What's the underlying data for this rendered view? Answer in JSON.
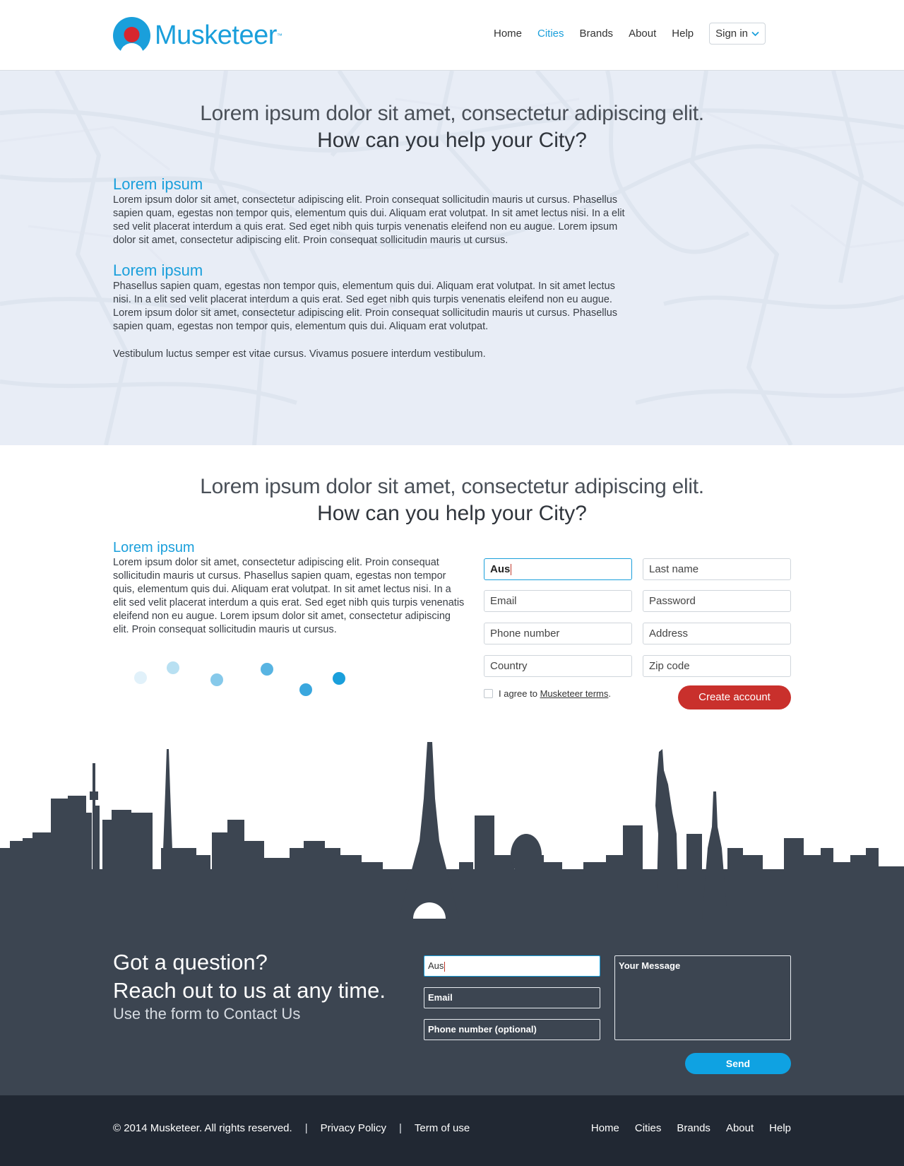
{
  "brand": {
    "name": "Musketeer",
    "tm": "™",
    "primary_color": "#1a9fdb",
    "accent_color": "#d7262e"
  },
  "nav": {
    "items": [
      {
        "label": "Home",
        "active": false
      },
      {
        "label": "Cities",
        "active": true
      },
      {
        "label": "Brands",
        "active": false
      },
      {
        "label": "About",
        "active": false
      },
      {
        "label": "Help",
        "active": false
      }
    ],
    "signin_label": "Sign in"
  },
  "info": {
    "title_light": "Lorem ipsum dolor sit amet, consectetur adipiscing elit.",
    "title_strong": "How can you help your City?",
    "sections": [
      {
        "heading": "Lorem ipsum",
        "text": "Lorem ipsum dolor sit amet, consectetur adipiscing elit. Proin consequat sollicitudin mauris ut cursus. Phasellus sapien quam, egestas non tempor quis, elementum quis dui. Aliquam erat volutpat. In sit amet lectus nisi. In a elit sed velit placerat interdum a quis erat. Sed eget nibh quis turpis venenatis eleifend non eu augue. Lorem ipsum dolor sit amet, consectetur adipiscing elit. Proin consequat sollicitudin mauris ut cursus."
      },
      {
        "heading": "Lorem ipsum",
        "text": "Phasellus sapien quam, egestas non tempor quis, elementum quis dui. Aliquam erat volutpat. In sit amet lectus nisi. In a elit sed velit placerat interdum a quis erat. Sed eget nibh quis turpis venenatis eleifend non eu augue. Lorem ipsum dolor sit amet, consectetur adipiscing elit. Proin consequat sollicitudin mauris ut cursus. Phasellus sapien quam, egestas non tempor quis, elementum quis dui. Aliquam erat volutpat."
      }
    ],
    "footnote": "Vestibulum luctus semper est vitae cursus. Vivamus posuere interdum vestibulum."
  },
  "signup": {
    "title_light": "Lorem ipsum dolor sit amet, consectetur adipiscing elit.",
    "title_strong": "How can you help your City?",
    "heading": "Lorem ipsum",
    "text": "Lorem ipsum dolor sit amet, consectetur adipiscing elit. Proin consequat sollicitudin mauris ut cursus. Phasellus sapien quam, egestas non tempor quis, elementum quis dui. Aliquam erat volutpat. In sit amet lectus nisi. In a elit sed velit placerat interdum a quis erat. Sed eget nibh quis turpis venenatis eleifend non eu augue. Lorem ipsum dolor sit amet, consectetur adipiscing elit. Proin consequat sollicitudin mauris ut cursus.",
    "fields": {
      "first_name_value": "Aus",
      "last_name_placeholder": "Last name",
      "email_placeholder": "Email",
      "password_placeholder": "Password",
      "phone_placeholder": "Phone number",
      "address_placeholder": "Address",
      "country_placeholder": "Country",
      "zip_placeholder": "Zip code"
    },
    "agree_prefix": "I agree to",
    "agree_link": "Musketeer terms",
    "agree_suffix": ".",
    "create_label": "Create account",
    "create_color": "#c9302c"
  },
  "contact": {
    "line1": "Got a question?",
    "line2": "Reach out to us at any time.",
    "line3": "Use the form to Contact Us",
    "name_value": "Aus",
    "email_placeholder": "Email",
    "phone_placeholder": "Phone number (optional)",
    "message_placeholder": "Your Message",
    "send_label": "Send",
    "send_color": "#0fa2e2"
  },
  "footer": {
    "copyright": "© 2014 Musketeer. All rights reserved.",
    "separator": "|",
    "privacy": "Privacy Policy",
    "terms": "Term of use",
    "links": [
      "Home",
      "Cities",
      "Brands",
      "About",
      "Help"
    ]
  }
}
